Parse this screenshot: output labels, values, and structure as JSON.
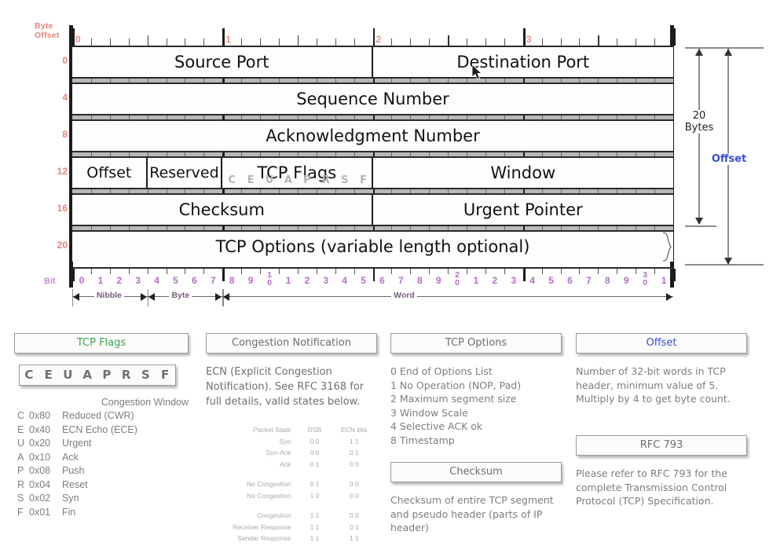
{
  "diagram": {
    "byte_offset_label": "Byte\nOffset",
    "byte_offset_line1": "Byte",
    "byte_offset_line2": "Offset",
    "bit_label": "Bit",
    "byte_ruler_numbers": [
      "0",
      "1",
      "2",
      "3"
    ],
    "row_offsets": [
      "0",
      "4",
      "8",
      "12",
      "16",
      "20"
    ],
    "rows": [
      {
        "cells": [
          {
            "label": "Source Port",
            "bits": 16
          },
          {
            "label": "Destination Port",
            "bits": 16
          }
        ]
      },
      {
        "cells": [
          {
            "label": "Sequence Number",
            "bits": 32
          }
        ]
      },
      {
        "cells": [
          {
            "label": "Acknowledgment Number",
            "bits": 32
          }
        ]
      },
      {
        "cells": [
          {
            "label": "Offset",
            "bits": 4
          },
          {
            "label": "Reserved",
            "bits": 4
          },
          {
            "label": "TCP  Flags",
            "bits": 8
          },
          {
            "label": "Window",
            "bits": 16
          }
        ]
      },
      {
        "cells": [
          {
            "label": "Checksum",
            "bits": 16
          },
          {
            "label": "Urgent Pointer",
            "bits": 16
          }
        ]
      },
      {
        "cells": [
          {
            "label": "TCP Options (variable length optional)",
            "bits": 32
          }
        ]
      }
    ],
    "flag_letters": [
      "C",
      "E",
      "U",
      "A",
      "P",
      "R",
      "S",
      "F"
    ],
    "bit_numbers": [
      "0",
      "1",
      "2",
      "3",
      "4",
      "5",
      "6",
      "7",
      "8",
      "9",
      "1\n0",
      "1",
      "2",
      "3",
      "4",
      "5",
      "6",
      "7",
      "8",
      "9",
      "2\n0",
      "1",
      "2",
      "3",
      "4",
      "5",
      "6",
      "7",
      "8",
      "9",
      "3\n0",
      "1"
    ],
    "scale_labels": [
      "Nibble",
      "Byte",
      "Word"
    ],
    "dimensions": {
      "bytes_line1": "20",
      "bytes_line2": "Bytes",
      "offset_label": "Offset"
    },
    "colors": {
      "byte_offset": "#e8827e",
      "bit": "#b070c0",
      "offset_accent": "#3b4cd6",
      "tcp_flags_accent": "#3aa34a"
    }
  },
  "legend": {
    "tcp_flags": {
      "title": "TCP Flags",
      "title_color": "#3aa34a",
      "flag_bar": [
        "C",
        "E",
        "U",
        "A",
        "P",
        "R",
        "S",
        "F"
      ],
      "congestion_window_note": "Congestion Window",
      "rows": [
        {
          "key": "C",
          "hex": "0x80",
          "desc": "Reduced (CWR)"
        },
        {
          "key": "E",
          "hex": "0x40",
          "desc": "ECN Echo (ECE)"
        },
        {
          "key": "U",
          "hex": "0x20",
          "desc": "Urgent"
        },
        {
          "key": "A",
          "hex": "0x10",
          "desc": "Ack"
        },
        {
          "key": "P",
          "hex": "0x08",
          "desc": "Push"
        },
        {
          "key": "R",
          "hex": "0x04",
          "desc": "Reset"
        },
        {
          "key": "S",
          "hex": "0x02",
          "desc": "Syn"
        },
        {
          "key": "F",
          "hex": "0x01",
          "desc": "Fin"
        }
      ]
    },
    "congestion_notification": {
      "title": "Congestion Notification",
      "body": "ECN (Explicit Congestion Notification).  See RFC 3168 for full details, valid states below.",
      "table": {
        "headers": [
          "Packet State",
          "DSB",
          "ECN bits"
        ],
        "groups": [
          [
            {
              "state": "Syn",
              "dsb": "0 0",
              "ecn": "1 1"
            },
            {
              "state": "Syn-Ack",
              "dsb": "0 0",
              "ecn": "0 1"
            },
            {
              "state": "Ack",
              "dsb": "0 1",
              "ecn": "0 0"
            }
          ],
          [
            {
              "state": "No Congestion",
              "dsb": "0 1",
              "ecn": "0 0"
            },
            {
              "state": "No Congestion",
              "dsb": "1 0",
              "ecn": "0 0"
            }
          ],
          [
            {
              "state": "Congestion",
              "dsb": "1 1",
              "ecn": "0 0"
            },
            {
              "state": "Receiver Response",
              "dsb": "1 1",
              "ecn": "0 1"
            },
            {
              "state": "Sender Response",
              "dsb": "1 1",
              "ecn": "1 1"
            }
          ]
        ]
      }
    },
    "tcp_options": {
      "title": "TCP Options",
      "items": [
        "0 End of Options List",
        "1 No Operation (NOP, Pad)",
        "2 Maximum segment size",
        "3 Window Scale",
        "4 Selective ACK ok",
        "8 Timestamp"
      ]
    },
    "checksum": {
      "title": "Checksum",
      "body": "Checksum of entire TCP segment and pseudo header (parts of IP header)"
    },
    "offset": {
      "title": "Offset",
      "title_color": "#3b4cd6",
      "body": "Number of 32-bit words in TCP header, minimum value of 5.  Multiply by 4 to get byte count."
    },
    "rfc793": {
      "title": "RFC 793",
      "body": "Please refer to RFC 793 for the complete Transmission Control Protocol (TCP) Specification."
    }
  }
}
